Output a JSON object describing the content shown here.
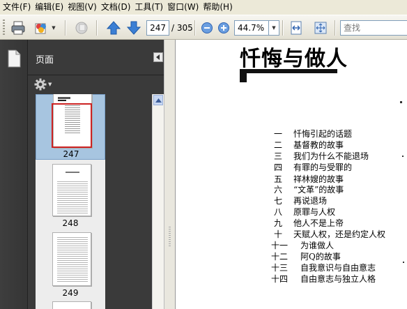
{
  "menu": [
    "文件(F)",
    "编辑(E)",
    "视图(V)",
    "文档(D)",
    "工具(T)",
    "窗口(W)",
    "帮助(H)"
  ],
  "toolbar": {
    "current_page": "247",
    "total_pages": "/ 305",
    "zoom": "44.7%",
    "search_placeholder": "查找"
  },
  "panel": {
    "title": "页面",
    "thumbnails": [
      {
        "label": "247",
        "selected": true
      },
      {
        "label": "248",
        "selected": false
      },
      {
        "label": "249",
        "selected": false
      }
    ]
  },
  "document": {
    "title": "忏悔与做人",
    "toc": [
      {
        "num": "一",
        "text": "忏悔引起的话题"
      },
      {
        "num": "二",
        "text": "基督教的故事"
      },
      {
        "num": "三",
        "text": "我们为什么不能退场"
      },
      {
        "num": "四",
        "text": "有罪的与受罪的"
      },
      {
        "num": "五",
        "text": "祥林嫂的故事"
      },
      {
        "num": "六",
        "text": "“文革”的故事"
      },
      {
        "num": "七",
        "text": "再说退场"
      },
      {
        "num": "八",
        "text": "原罪与人权"
      },
      {
        "num": "九",
        "text": "他人不是上帝"
      },
      {
        "num": "十",
        "text": "天赋人权，还是约定人权"
      },
      {
        "num": "十一",
        "text": "为谁做人"
      },
      {
        "num": "十二",
        "text": "阿Q的故事"
      },
      {
        "num": "十三",
        "text": "自我意识与自由意志"
      },
      {
        "num": "十四",
        "text": "自由意志与独立人格"
      }
    ]
  },
  "colors": {
    "selection": "#a7c5e0",
    "thumb_border": "#cc2222",
    "panel_bg": "#3a3a3a"
  }
}
